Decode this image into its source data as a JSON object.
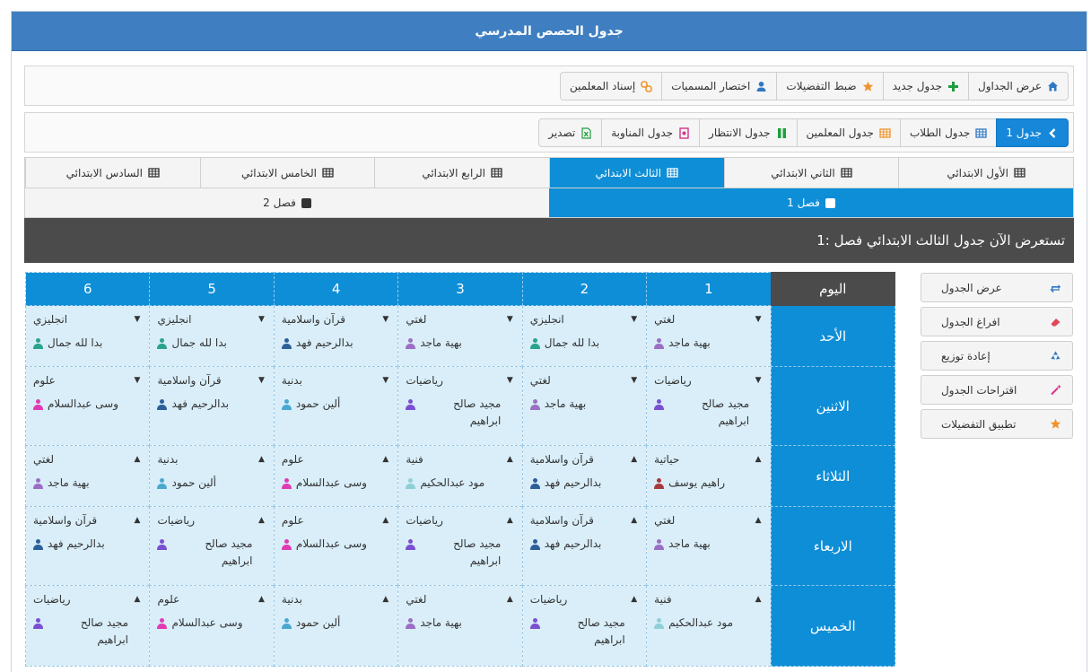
{
  "title": "جدول الحصص المدرسي",
  "toolbar1": [
    {
      "label": "عرض الجداول",
      "icon": "home-icon",
      "color": "#2f78c4",
      "active": false
    },
    {
      "label": "جدول جديد",
      "icon": "plus-icon",
      "color": "#1f9e3c",
      "active": false
    },
    {
      "label": "ضبط التفضيلات",
      "icon": "star-icon",
      "color": "#f0932a",
      "active": false
    },
    {
      "label": "اختصار المسميات",
      "icon": "user-icon",
      "color": "#2f78c4",
      "active": false
    },
    {
      "label": "إسناد المعلمين",
      "icon": "link-icon",
      "color": "#f0932a",
      "active": false
    }
  ],
  "toolbar2": [
    {
      "label": "جدول 1",
      "icon": "chevron-left-icon",
      "color": "#ffffff",
      "active": true
    },
    {
      "label": "جدول الطلاب",
      "icon": "table-icon",
      "color": "#2f78c4",
      "active": false
    },
    {
      "label": "جدول المعلمين",
      "icon": "table-icon",
      "color": "#f0932a",
      "active": false
    },
    {
      "label": "جدول الانتظار",
      "icon": "columns-icon",
      "color": "#1f9e3c",
      "active": false
    },
    {
      "label": "جدول المناوبة",
      "icon": "shield-icon",
      "color": "#d6338a",
      "active": false
    },
    {
      "label": "تصدير",
      "icon": "excel-file-icon",
      "color": "#1f9e3c",
      "active": false
    }
  ],
  "grades": [
    {
      "label": "الأول الابتدائي",
      "active": false
    },
    {
      "label": "الثاني الابتدائي",
      "active": false
    },
    {
      "label": "الثالث الابتدائي",
      "active": true
    },
    {
      "label": "الرابع الابتدائي",
      "active": false
    },
    {
      "label": "الخامس الابتدائي",
      "active": false
    },
    {
      "label": "السادس الابتدائي",
      "active": false
    }
  ],
  "classes": [
    {
      "label": "فصل 1",
      "active": true
    },
    {
      "label": "فصل 2",
      "active": false
    }
  ],
  "info": "تستعرض الآن جدول الثالث الابتدائي فصل :1",
  "side_buttons": [
    {
      "label": "عرض الجدول",
      "icon": "refresh-icon",
      "color": "#2f78c4"
    },
    {
      "label": "افراغ الجدول",
      "icon": "eraser-icon",
      "color": "#e0485a"
    },
    {
      "label": "إعادة توزيع",
      "icon": "recycle-icon",
      "color": "#2f78c4"
    },
    {
      "label": "اقتراحات الجدول",
      "icon": "magic-wand-icon",
      "color": "#d6338a"
    },
    {
      "label": "تطبيق التفضيلات",
      "icon": "star-icon",
      "color": "#f0932a"
    }
  ],
  "table": {
    "day_header": "اليوم",
    "periods": [
      "1",
      "2",
      "3",
      "4",
      "5",
      "6"
    ],
    "rows": [
      {
        "day": "الأحد",
        "caret": "▼",
        "cells": [
          {
            "subject": "لغتي",
            "teacher": "بهية ماجد",
            "color": "#9b6fc4"
          },
          {
            "subject": "انجليزي",
            "teacher": "بدا لله جمال",
            "color": "#2aa38c"
          },
          {
            "subject": "لغتي",
            "teacher": "بهية ماجد",
            "color": "#9b6fc4"
          },
          {
            "subject": "قرآن واسلامية",
            "teacher": "بدالرحيم فهد",
            "color": "#2d5f9a"
          },
          {
            "subject": "انجليزي",
            "teacher": "بدا لله جمال",
            "color": "#2aa38c"
          },
          {
            "subject": "انجليزي",
            "teacher": "بدا لله جمال",
            "color": "#2aa38c"
          }
        ]
      },
      {
        "day": "الاثنين",
        "caret": "▼",
        "cells": [
          {
            "subject": "رياضيات",
            "teacher": "مجيد صالح ابراهيم",
            "color": "#7a4fd1"
          },
          {
            "subject": "لغتي",
            "teacher": "بهية ماجد",
            "color": "#9b6fc4"
          },
          {
            "subject": "رياضيات",
            "teacher": "مجيد صالح ابراهيم",
            "color": "#7a4fd1"
          },
          {
            "subject": "بدنية",
            "teacher": "ألين حمود",
            "color": "#4aa8d0"
          },
          {
            "subject": "قرآن واسلامية",
            "teacher": "بدالرحيم فهد",
            "color": "#2d5f9a"
          },
          {
            "subject": "علوم",
            "teacher": "وسى عبدالسلام",
            "color": "#e03bb5"
          }
        ]
      },
      {
        "day": "الثلاثاء",
        "caret": "▲",
        "cells": [
          {
            "subject": "حياتية",
            "teacher": "راهيم يوسف",
            "color": "#a83a3a"
          },
          {
            "subject": "قرآن واسلامية",
            "teacher": "بدالرحيم فهد",
            "color": "#2d5f9a"
          },
          {
            "subject": "فنية",
            "teacher": "مود عبدالحكيم",
            "color": "#8fd0d6"
          },
          {
            "subject": "علوم",
            "teacher": "وسى عبدالسلام",
            "color": "#e03bb5"
          },
          {
            "subject": "بدنية",
            "teacher": "ألين حمود",
            "color": "#4aa8d0"
          },
          {
            "subject": "لغتي",
            "teacher": "بهية ماجد",
            "color": "#9b6fc4"
          }
        ]
      },
      {
        "day": "الاربعاء",
        "caret": "▲",
        "cells": [
          {
            "subject": "لغتي",
            "teacher": "بهية ماجد",
            "color": "#9b6fc4"
          },
          {
            "subject": "قرآن واسلامية",
            "teacher": "بدالرحيم فهد",
            "color": "#2d5f9a"
          },
          {
            "subject": "رياضيات",
            "teacher": "مجيد صالح ابراهيم",
            "color": "#7a4fd1"
          },
          {
            "subject": "علوم",
            "teacher": "وسى عبدالسلام",
            "color": "#e03bb5"
          },
          {
            "subject": "رياضيات",
            "teacher": "مجيد صالح ابراهيم",
            "color": "#7a4fd1"
          },
          {
            "subject": "قرآن واسلامية",
            "teacher": "بدالرحيم فهد",
            "color": "#2d5f9a"
          }
        ]
      },
      {
        "day": "الخميس",
        "caret": "▲",
        "cells": [
          {
            "subject": "فنية",
            "teacher": "مود عبدالحكيم",
            "color": "#8fd0d6"
          },
          {
            "subject": "رياضيات",
            "teacher": "مجيد صالح ابراهيم",
            "color": "#7a4fd1"
          },
          {
            "subject": "لغتي",
            "teacher": "بهية ماجد",
            "color": "#9b6fc4"
          },
          {
            "subject": "بدنية",
            "teacher": "ألين حمود",
            "color": "#4aa8d0"
          },
          {
            "subject": "علوم",
            "teacher": "وسى عبدالسلام",
            "color": "#e03bb5"
          },
          {
            "subject": "رياضيات",
            "teacher": "مجيد صالح ابراهيم",
            "color": "#7a4fd1"
          }
        ]
      }
    ]
  }
}
